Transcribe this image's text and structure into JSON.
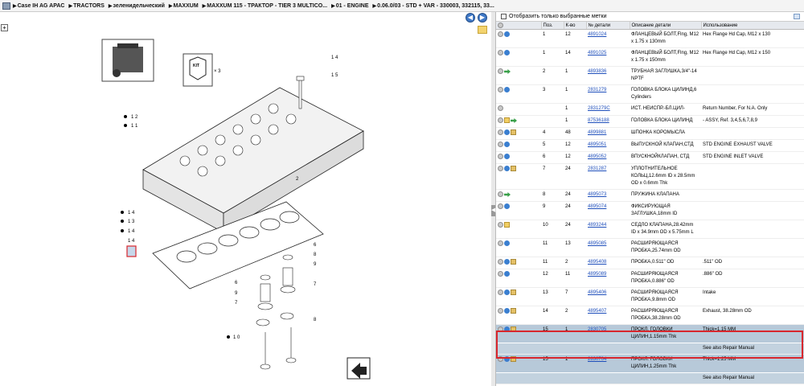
{
  "breadcrumb": [
    "Case IH AG APAC",
    "TRACTORS",
    "зеленидельческий",
    "MAXXUM",
    "MAXXUM 115 - ТРАКТОР - TIER 3 MULTICO...",
    "01 - ENGINE",
    "0.06.0/03 - STD + VAR - 330003, 332115, 33..."
  ],
  "diagram": {
    "kit_label": "KIT",
    "kit_x3": "× 3",
    "callouts": [
      "1 4",
      "1 5",
      "1 2",
      "1 1",
      "2",
      "1 4",
      "1 3",
      "1 4",
      "1 4",
      "6",
      "8",
      "9",
      "6",
      "9",
      "7",
      "7",
      "8",
      "1 0"
    ]
  },
  "filter": {
    "label": "Отобразить только выбранные метки"
  },
  "table": {
    "headers": [
      "",
      "Поз.",
      "К-во",
      "№ детали",
      "Описание детали",
      "Использование"
    ],
    "rows": [
      {
        "icons": [
          "gear",
          "info"
        ],
        "pos": "1",
        "qty": "12",
        "part": "4891024",
        "desc": "ФЛАНЦЕВЫЙ БОЛТ,Flng, M12 x 1.75 x 130mm",
        "use": "Hex Flange Hd Cap, M12 x 130"
      },
      {
        "icons": [
          "gear",
          "info"
        ],
        "pos": "1",
        "qty": "14",
        "part": "4891025",
        "desc": "ФЛАНЦЕВЫЙ БОЛТ,Flng, M12 x 1.75 x 150mm",
        "use": "Hex Flange Hd Cap, M12 x 150"
      },
      {
        "icons": [
          "gear",
          "arrow"
        ],
        "pos": "2",
        "qty": "1",
        "part": "4893836",
        "desc": "ТРУБНАЯ ЗАГЛУШКА,3/4\"-14 NPTF",
        "use": ""
      },
      {
        "icons": [
          "gear",
          "info"
        ],
        "pos": "3",
        "qty": "1",
        "part": "2831279",
        "desc": "ГОЛОВКА БЛОКА ЦИЛИНД,6 Cylinders",
        "use": ""
      },
      {
        "icons": [
          "gear"
        ],
        "pos": "",
        "qty": "1",
        "part": "2831279C",
        "desc": "ИСТ. НЕИСПР.-БЛ.ЦИЛ-",
        "use": "Return Number, For N.A. Only"
      },
      {
        "icons": [
          "gear",
          "box",
          "arrow"
        ],
        "pos": "",
        "qty": "1",
        "part": "87536188",
        "desc": "ГОЛОВКА БЛОКА ЦИЛИНД",
        "use": "- ASSY, Ref. 3,4,5,6,7,8,9"
      },
      {
        "icons": [
          "gear",
          "info",
          "pkg"
        ],
        "pos": "4",
        "qty": "48",
        "part": "4899881",
        "desc": "ШПОНКА КОРОМЫСЛА",
        "use": ""
      },
      {
        "icons": [
          "gear",
          "info"
        ],
        "pos": "5",
        "qty": "12",
        "part": "4895051",
        "desc": "ВЫПУСКНОЙ КЛАПАН,СТД",
        "use": "STD ENGINE EXHAUST VALVE"
      },
      {
        "icons": [
          "gear",
          "info"
        ],
        "pos": "6",
        "qty": "12",
        "part": "4895052",
        "desc": "ВПУСКНОЙКЛАПАН, СТД",
        "use": "STD ENGINE INLET VALVE"
      },
      {
        "icons": [
          "gear",
          "info",
          "pkg"
        ],
        "pos": "7",
        "qty": "24",
        "part": "2831287",
        "desc": "УПЛОТНИТЕЛЬНОЕ КОЛЬЦ,12.6mm ID x 28.5mm OD x 0.6mm Thk",
        "use": ""
      },
      {
        "icons": [
          "gear",
          "arrow"
        ],
        "pos": "8",
        "qty": "24",
        "part": "4895073",
        "desc": "ПРУЖИНА КЛАПАНА",
        "use": ""
      },
      {
        "icons": [
          "gear",
          "info"
        ],
        "pos": "9",
        "qty": "24",
        "part": "4895074",
        "desc": "ФИКСИРУЮЩАЯ ЗАГЛУШКА,18mm ID",
        "use": ""
      },
      {
        "icons": [
          "gear",
          "box"
        ],
        "pos": "10",
        "qty": "24",
        "part": "4893244",
        "desc": "СЕДЛО КЛАПАНА,28.42mm ID x 34.9mm OD x 5.75mm L",
        "use": ""
      },
      {
        "icons": [
          "gear",
          "info"
        ],
        "pos": "11",
        "qty": "13",
        "part": "4895085",
        "desc": "РАСШИРЯЮЩАЯСЯ ПРОБКА,25.74mm OD",
        "use": ""
      },
      {
        "icons": [
          "gear",
          "info",
          "pkg"
        ],
        "pos": "11",
        "qty": "2",
        "part": "4895408",
        "desc": "ПРОБКА,0.511\" OD",
        "use": ".511\" OD"
      },
      {
        "icons": [
          "gear",
          "info"
        ],
        "pos": "12",
        "qty": "11",
        "part": "4895089",
        "desc": "РАСШИРЯЮЩАЯСЯ ПРОБКА,0.886\" OD",
        "use": ".886\" OD"
      },
      {
        "icons": [
          "gear",
          "info",
          "pkg"
        ],
        "pos": "13",
        "qty": "7",
        "part": "4895406",
        "desc": "РАСШИРЯЮЩАЯСЯ ПРОБКА,9.8mm OD",
        "use": "Intake"
      },
      {
        "icons": [
          "gear",
          "info",
          "pkg"
        ],
        "pos": "14",
        "qty": "2",
        "part": "4895407",
        "desc": "РАСШИРЯЮЩАЯСЯ ПРОБКА,38.28mm OD",
        "use": "Exhaust, 38.28mm OD"
      },
      {
        "icons": [
          "gear",
          "info",
          "pkg"
        ],
        "pos": "15",
        "qty": "1",
        "part": "2830705",
        "desc": "ПРОКЛ. ГОЛОВКИ ЦИЛИН,1.15mm Thk",
        "use": "Thick=1.15 MM",
        "sel": true
      },
      {
        "note": "See also Repair Manual",
        "sel": true
      },
      {
        "icons": [
          "gear",
          "info",
          "pkg"
        ],
        "pos": "15",
        "qty": "1",
        "part": "2830704",
        "desc": "ПРОКЛ. ГОЛОВКИ ЦИЛИН,1.25mm Thk",
        "use": "Thick=1.25 MM",
        "sel": true
      },
      {
        "note": "See also Repair Manual",
        "sel": true
      }
    ]
  }
}
